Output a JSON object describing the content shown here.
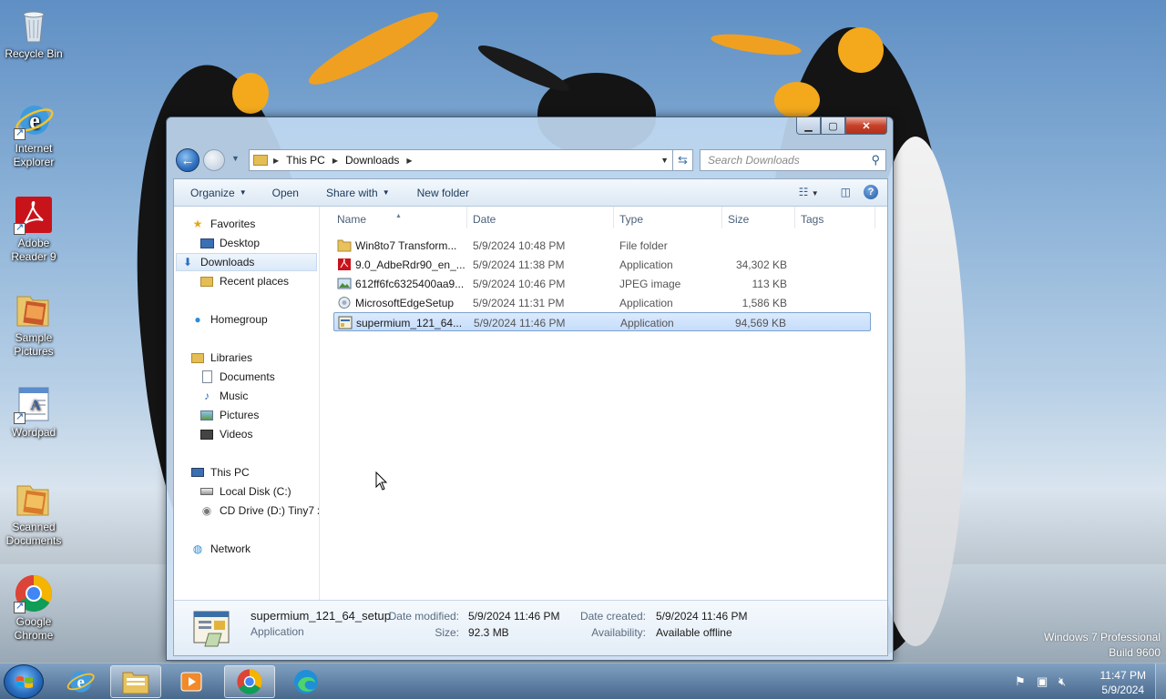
{
  "desktop": {
    "icons": [
      {
        "label": "Recycle Bin"
      },
      {
        "label": "Internet Explorer"
      },
      {
        "label": "Adobe Reader 9"
      },
      {
        "label": "Sample Pictures"
      },
      {
        "label": "Wordpad"
      },
      {
        "label": "Scanned Documents"
      },
      {
        "label": "Google Chrome"
      }
    ],
    "watermark_line1": "Windows 7 Professional",
    "watermark_line2": "Build 9600"
  },
  "window": {
    "address": {
      "crumbs": [
        "This PC",
        "Downloads"
      ]
    },
    "search_placeholder": "Search Downloads",
    "toolbar": {
      "organize": "Organize",
      "open": "Open",
      "share_with": "Share with",
      "new_folder": "New folder"
    },
    "nav": {
      "favorites": "Favorites",
      "desktop": "Desktop",
      "downloads": "Downloads",
      "recent_places": "Recent places",
      "homegroup": "Homegroup",
      "libraries": "Libraries",
      "documents": "Documents",
      "music": "Music",
      "pictures": "Pictures",
      "videos": "Videos",
      "this_pc": "This PC",
      "local_disk": "Local Disk (C:)",
      "cd_drive": "CD Drive (D:) Tiny7 x",
      "network": "Network"
    },
    "columns": {
      "name": "Name",
      "date": "Date",
      "type": "Type",
      "size": "Size",
      "tags": "Tags"
    },
    "files": [
      {
        "name": "Win8to7 Transform...",
        "date": "5/9/2024 10:48 PM",
        "type": "File folder",
        "size": ""
      },
      {
        "name": "9.0_AdbeRdr90_en_...",
        "date": "5/9/2024 11:38 PM",
        "type": "Application",
        "size": "34,302 KB"
      },
      {
        "name": "612ff6fc6325400aa9...",
        "date": "5/9/2024 10:46 PM",
        "type": "JPEG image",
        "size": "113 KB"
      },
      {
        "name": "MicrosoftEdgeSetup",
        "date": "5/9/2024 11:31 PM",
        "type": "Application",
        "size": "1,586 KB"
      },
      {
        "name": "supermium_121_64...",
        "date": "5/9/2024 11:46 PM",
        "type": "Application",
        "size": "94,569 KB"
      }
    ],
    "details": {
      "filename": "supermium_121_64_setup",
      "filetype": "Application",
      "date_modified_label": "Date modified:",
      "date_modified": "5/9/2024 11:46 PM",
      "size_label": "Size:",
      "size": "92.3 MB",
      "date_created_label": "Date created:",
      "date_created": "5/9/2024 11:46 PM",
      "availability_label": "Availability:",
      "availability": "Available offline"
    }
  },
  "taskbar": {
    "time": "11:47 PM",
    "date": "5/9/2024"
  }
}
